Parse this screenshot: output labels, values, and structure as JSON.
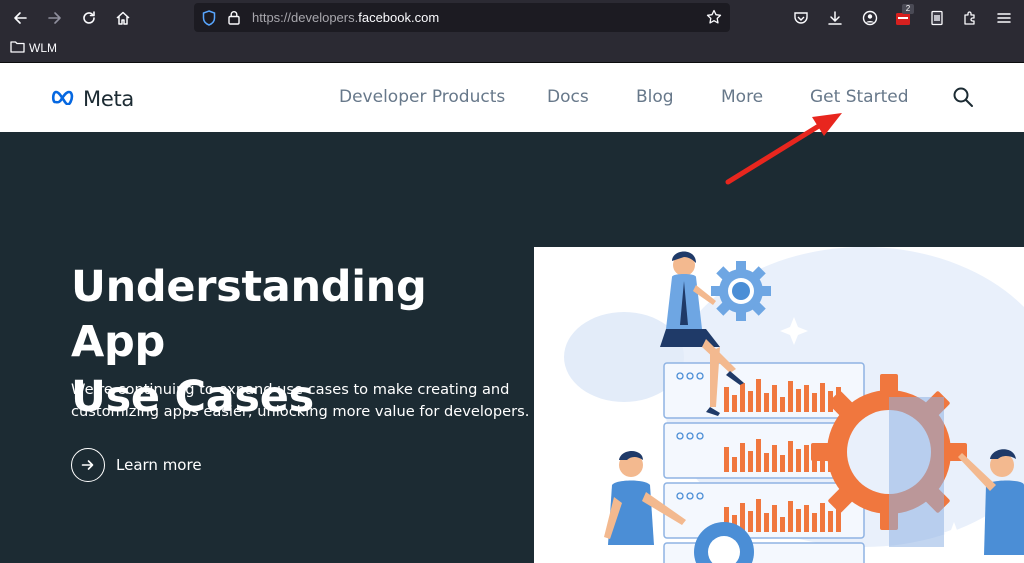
{
  "browser": {
    "url_prefix": "https://developers.",
    "url_domain": "facebook.com",
    "extension_badge": "2",
    "bookmark_label": "WLM",
    "icons": [
      "back-icon",
      "forward-icon",
      "reload-icon",
      "home-icon",
      "shield-icon",
      "lock-icon",
      "star-icon",
      "pocket-icon",
      "download-icon",
      "account-icon",
      "extension-icon",
      "menu-icon"
    ]
  },
  "header": {
    "logo_text": "Meta",
    "nav": {
      "developer_products": "Developer Products",
      "docs": "Docs",
      "blog": "Blog",
      "more": "More",
      "get_started": "Get Started"
    }
  },
  "hero": {
    "title_line1": "Understanding App",
    "title_line2": "Use Cases",
    "subtitle_line1": "We’re continuing to expand use cases to make creating and",
    "subtitle_line2": "customizing apps easier, unlocking more value for developers.",
    "cta_label": "Learn more"
  },
  "colors": {
    "hero_bg": "#1c2b33",
    "meta_blue": "#0668e1",
    "nav_text": "#67788a",
    "illus_orange": "#f0773e",
    "illus_blue": "#4b8ed6",
    "annotation_red": "#e8261e"
  }
}
